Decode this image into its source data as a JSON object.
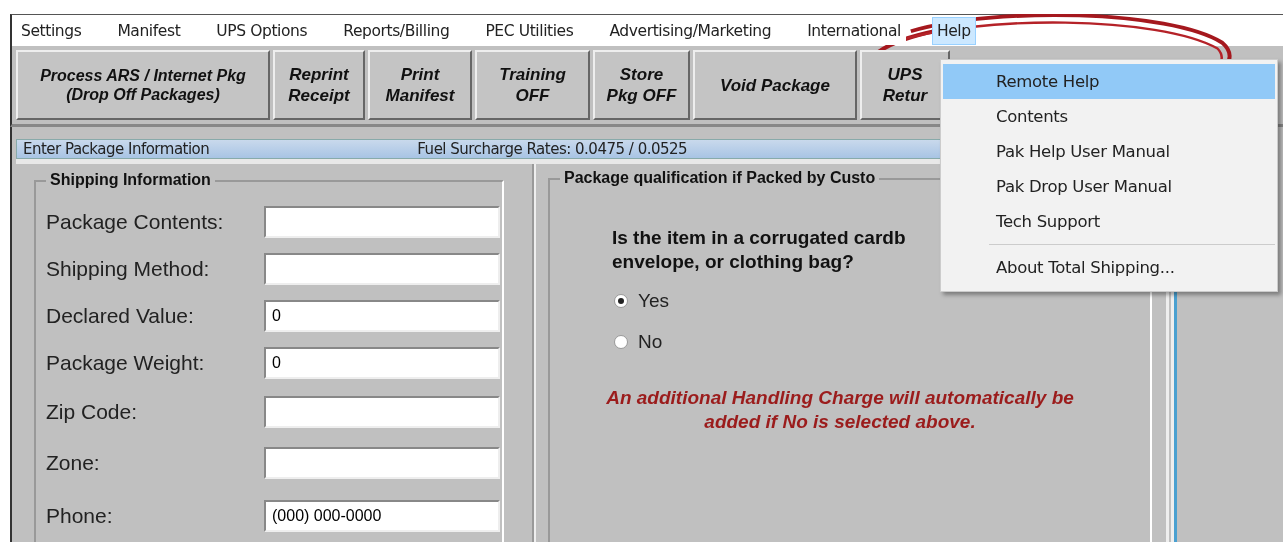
{
  "menu_bar": [
    {
      "label": "Settings",
      "selected": false
    },
    {
      "label": "Manifest",
      "selected": false
    },
    {
      "label": "UPS Options",
      "selected": false
    },
    {
      "label": "Reports/Billing",
      "selected": false
    },
    {
      "label": "PEC Utilities",
      "selected": false
    },
    {
      "label": "Advertising/Marketing",
      "selected": false
    },
    {
      "label": "International",
      "selected": false
    },
    {
      "label": "Help",
      "selected": true
    }
  ],
  "toolbar": [
    {
      "lines": [
        "Process ARS / Internet Pkg",
        "(Drop Off Packages)"
      ]
    },
    {
      "lines": [
        "Reprint",
        "Receipt"
      ]
    },
    {
      "lines": [
        "Print",
        "Manifest"
      ]
    },
    {
      "lines": [
        "Training",
        "OFF"
      ]
    },
    {
      "lines": [
        "Store",
        "Pkg OFF"
      ]
    },
    {
      "lines": [
        "Void Package"
      ]
    },
    {
      "lines": [
        "UPS",
        "Retur"
      ]
    }
  ],
  "help_menu": [
    {
      "kind": "item",
      "label": "Remote Help",
      "selected": true
    },
    {
      "kind": "item",
      "label": "Contents",
      "selected": false
    },
    {
      "kind": "item",
      "label": "Pak Help User Manual",
      "selected": false
    },
    {
      "kind": "item",
      "label": "Pak Drop User Manual",
      "selected": false
    },
    {
      "kind": "item",
      "label": "Tech Support",
      "selected": false
    },
    {
      "kind": "separator"
    },
    {
      "kind": "item",
      "label": "About Total Shipping...",
      "selected": false
    }
  ],
  "panel": {
    "title": "Enter Package Information",
    "fuel_surcharge": "Fuel Surcharge Rates: 0.0475 / 0.0525"
  },
  "shipping_information": {
    "title": "Shipping Information",
    "fields": [
      {
        "label": "Package Contents:"
      },
      {
        "label": "Shipping Method:"
      },
      {
        "label": "Declared Value:",
        "value": "0"
      },
      {
        "label": "Package Weight:",
        "value": "0"
      },
      {
        "label": "Zip Code:"
      },
      {
        "label": "Zone:"
      },
      {
        "label": "Phone:",
        "value": "(000) 000-0000"
      }
    ]
  },
  "qualification": {
    "title": "Package qualification if Packed by Custo",
    "question_lines": [
      "Is the item in a corrugated cardb",
      "envelope, or clothing bag?"
    ],
    "options": [
      {
        "label": "Yes",
        "selected": true
      },
      {
        "label": "No",
        "selected": false
      }
    ],
    "note_lines": [
      "An additional Handling Charge will automatically be",
      "added if No is selected above."
    ]
  }
}
